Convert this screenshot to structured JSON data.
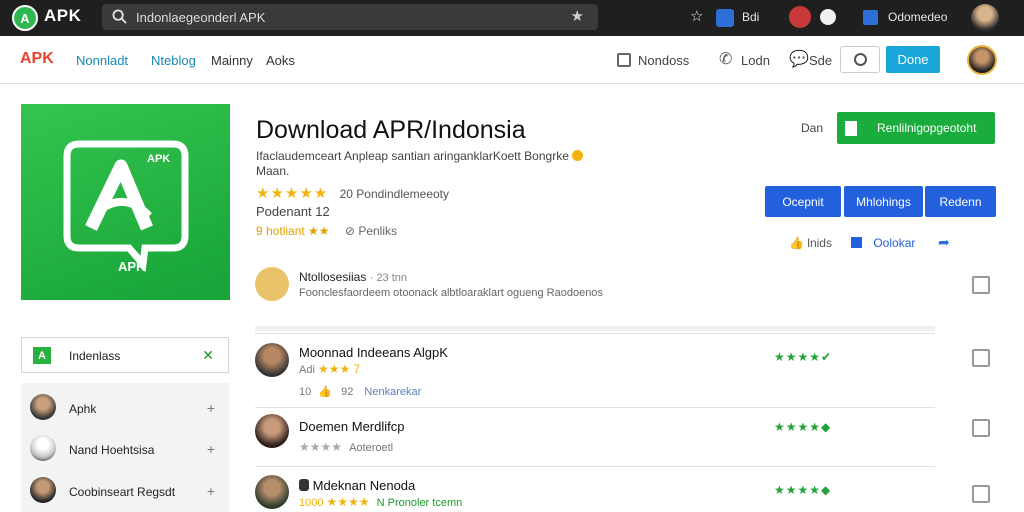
{
  "topbar": {
    "brand": "APK",
    "search_value": "Indonlaegeonderl APK",
    "notif_count": "Bdi",
    "account_label": "Odomedeo"
  },
  "navbar": {
    "brand": "APK",
    "links": [
      "Nonnladt",
      "Nteblog",
      "Mainny",
      "Aoks"
    ],
    "nondoss": "Nondoss",
    "lodn": "Lodn",
    "sde": "Sde",
    "done_label": "Done"
  },
  "app": {
    "icon_label": "APK",
    "icon_small_label": "APK",
    "title": "Download APR/Indonsia",
    "desc_line1": "Ifaclaudemceart Anpleap santian aringanklarKoett Bongrke",
    "desc_line2": "Maan.",
    "stars": "★★★★★",
    "rating_text": "20 Pondindlemeeoty",
    "version": "Podenant 12",
    "rating2_prefix": "9 hotliant",
    "rating2_stars": "★★",
    "rating2_link": "Penliks"
  },
  "actions": {
    "label": "Dan",
    "main_button": "Renlilnigopgeotoht",
    "blue_buttons": [
      "Ocepnit",
      "Mhlohings",
      "Redenn"
    ],
    "small_likes": "lnids",
    "small_share": "Oolokar"
  },
  "top_review": {
    "title": "Ntollosesiias",
    "meta": "23 tnn",
    "text": "Foonclesfaordeem otoonack albtloaraklart ogueng Raodoenos"
  },
  "reviews": [
    {
      "name": "Moonnad Indeeans AlgpK",
      "sub_prefix": "Adi",
      "sub_stars": "★★★",
      "sub_extra": "7",
      "rating": "★★★★✔"
    },
    {
      "name": "Doemen Merdlifcp",
      "sub_prefix": "",
      "sub_stars": "★★★★",
      "sub_extra": "Aoteroetl",
      "rating": "★★★★◆"
    },
    {
      "name": "Mdeknan Nenoda",
      "sub_prefix": "1000",
      "sub_stars": "★★★★",
      "sub_extra": "N Pronoler tcemn",
      "rating": "★★★★◆"
    }
  ],
  "review1_meta": {
    "likes": "10",
    "count": "92",
    "tag": "Nenkarekar"
  },
  "sidebar": {
    "selected_label": "Indenlass",
    "items": [
      {
        "label": "Aphk"
      },
      {
        "label": "Nand Hoehtsisa"
      },
      {
        "label": "Coobinseart Regsdt"
      }
    ]
  },
  "colors": {
    "accent_green": "#1aad3d",
    "accent_blue": "#2360dd",
    "brand_red": "#e8432f",
    "topbar_dark": "#1f1f1f"
  }
}
